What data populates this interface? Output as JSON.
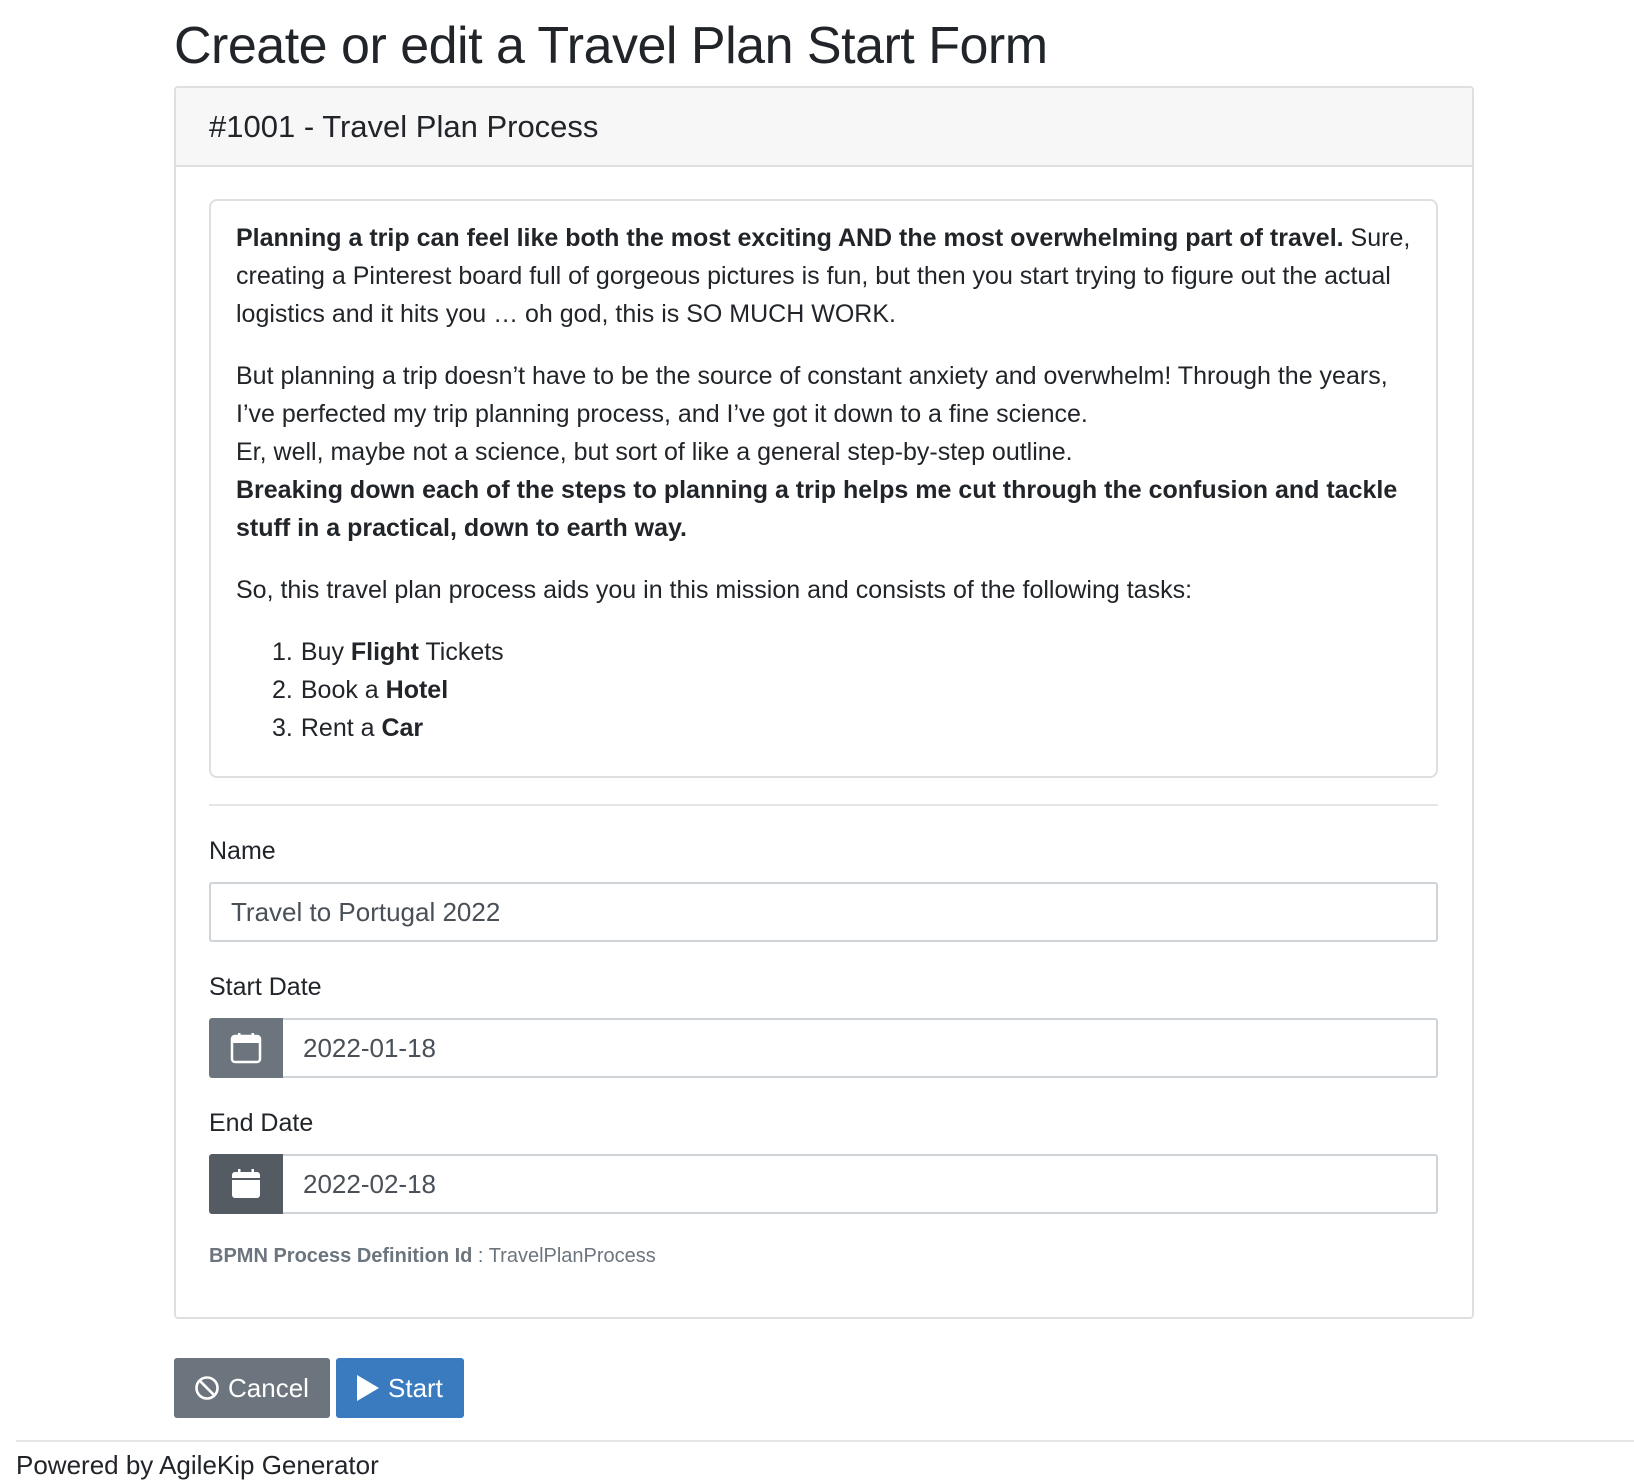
{
  "page": {
    "title": "Create or edit a Travel Plan Start Form"
  },
  "card": {
    "header": "#1001 - Travel Plan Process"
  },
  "description": {
    "intro_bold": "Planning a trip can feel like both the most exciting AND the most overwhelming part of travel.",
    "intro_rest": "Sure, creating a Pinterest board full of gorgeous pictures is fun, but then you start trying to figure out the actual logistics and it hits you … oh god, this is SO MUCH WORK.",
    "para2_line1": "But planning a trip doesn’t have to be the source of constant anxiety and overwhelm! Through the years, I’ve perfected my trip planning process, and I’ve got it down to a fine science.",
    "para2_line2": "Er, well, maybe not a science, but sort of like a general step-by-step outline.",
    "para2_bold": "Breaking down each of the steps to planning a trip helps me cut through the confusion and tackle stuff in a practical, down to earth way.",
    "para3": "So, this travel plan process aids you in this mission and consists of the following tasks:",
    "tasks": [
      {
        "num": "1.",
        "pre": "Buy ",
        "bold": "Flight",
        "post": " Tickets"
      },
      {
        "num": "2.",
        "pre": "Book a ",
        "bold": "Hotel",
        "post": ""
      },
      {
        "num": "3.",
        "pre": "Rent a ",
        "bold": "Car",
        "post": ""
      }
    ]
  },
  "form": {
    "name_label": "Name",
    "name_value": "Travel to Portugal 2022",
    "start_label": "Start Date",
    "start_value": "2022-01-18",
    "end_label": "End Date",
    "end_value": "2022-02-18",
    "bpmn_label": "BPMN Process Definition Id",
    "bpmn_sep": " : ",
    "bpmn_value": "TravelPlanProcess"
  },
  "actions": {
    "cancel_label": "Cancel",
    "cancel_icon": "ban-icon",
    "start_label": "Start",
    "start_icon": "play-icon"
  },
  "footer": {
    "text": "Powered by AgileKip Generator"
  },
  "colors": {
    "secondary": "#6c757d",
    "primary": "#3a7bc0",
    "card_header_bg": "#f7f7f7"
  }
}
